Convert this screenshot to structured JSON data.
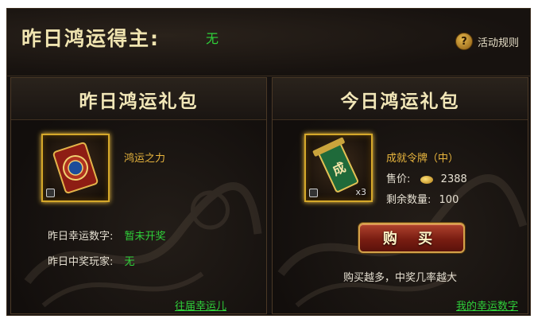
{
  "header": {
    "title": "昨日鸿运得主:",
    "winner": "无",
    "rules_label": "活动规则",
    "rules_icon": "?"
  },
  "left_panel": {
    "title": "昨日鸿运礼包",
    "item_name": "鸿运之力",
    "lucky_number_label": "昨日幸运数字:",
    "lucky_number_value": "暂未开奖",
    "winner_label": "昨日中奖玩家:",
    "winner_value": "无",
    "history_link": "往届幸运儿"
  },
  "right_panel": {
    "title": "今日鸿运礼包",
    "item_name": "成就令牌（中）",
    "item_quantity": "x3",
    "price_label": "售价:",
    "price_value": "2388",
    "remaining_label": "剩余数量:",
    "remaining_value": "100",
    "buy_label": "购 买",
    "note": "购买越多，中奖几率越大",
    "my_numbers_link": "我的幸运数字"
  },
  "colors": {
    "accent_green": "#2fd23a",
    "gold_text": "#e9b63e",
    "title_text": "#f2e7b8"
  }
}
